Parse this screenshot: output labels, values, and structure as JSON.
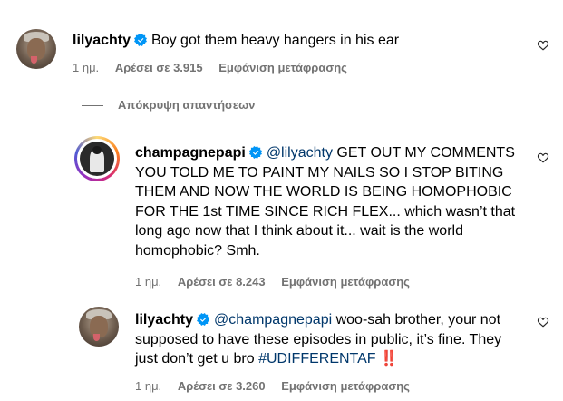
{
  "comments": [
    {
      "username": "lilyachty",
      "text": "Boy got them heavy hangers in his ear",
      "time": "1 ημ.",
      "likes": "Αρέσει σε 3.915",
      "translate": "Εμφάνιση μετάφρασης"
    }
  ],
  "hide_replies": "Απόκρυψη απαντήσεων",
  "replies": [
    {
      "username": "champagnepapi",
      "mention": "@lilyachty",
      "text": " GET OUT MY COMMENTS YOU TOLD ME TO PAINT MY NAILS SO I STOP BITING THEM AND NOW THE WORLD IS BEING HOMOPHOBIC FOR THE 1st TIME SINCE RICH FLEX... which wasn’t that long ago now that I think about it... wait is the world homophobic? Smh.",
      "time": "1 ημ.",
      "likes": "Αρέσει σε 8.243",
      "translate": "Εμφάνιση μετάφρασης"
    },
    {
      "username": "lilyachty",
      "mention": "@champagnepapi",
      "text_before_hashtag": " woo-sah brother, your not supposed to have these episodes in public, it’s fine. They just don’t get u bro ",
      "hashtag": "#UDIFFERENTAF",
      "text_after_hashtag": " ‼️",
      "time": "1 ημ.",
      "likes": "Αρέσει σε 3.260",
      "translate": "Εμφάνιση μετάφρασης"
    }
  ],
  "icons": {
    "verified": "verified-badge-icon",
    "like": "heart-outline-icon"
  },
  "colors": {
    "verified_blue": "#0095f6",
    "link": "#00376b",
    "meta_gray": "#737373"
  }
}
